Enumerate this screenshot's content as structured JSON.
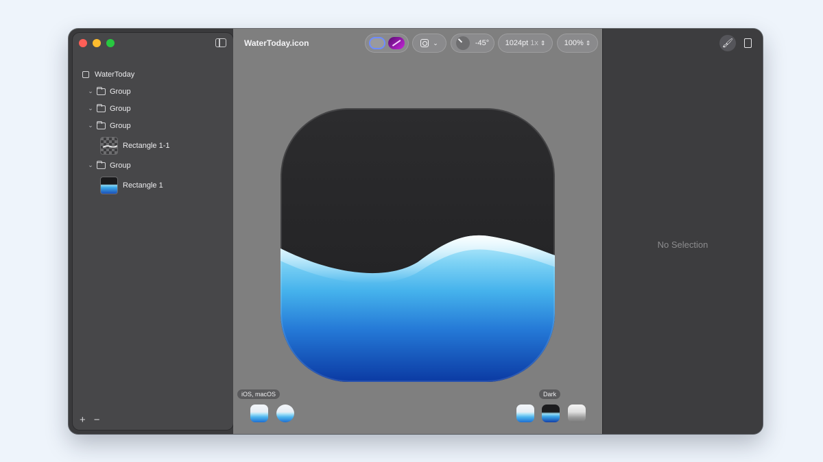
{
  "document": {
    "title": "WaterToday.icon"
  },
  "toolbar": {
    "angle": "-45°",
    "size": "1024pt",
    "scale": "1x",
    "zoom": "100%"
  },
  "sidebar": {
    "items": [
      {
        "label": "WaterToday",
        "kind": "document",
        "depth": 0
      },
      {
        "label": "Group",
        "kind": "group",
        "depth": 1
      },
      {
        "label": "Group",
        "kind": "group",
        "depth": 1
      },
      {
        "label": "Group",
        "kind": "group",
        "depth": 1
      },
      {
        "label": "Rectangle 1-1",
        "kind": "layer",
        "depth": 2,
        "thumb": "checker"
      },
      {
        "label": "Group",
        "kind": "group",
        "depth": 1
      },
      {
        "label": "Rectangle 1",
        "kind": "layer",
        "depth": 2,
        "thumb": "water"
      }
    ],
    "add_label": "+",
    "remove_label": "−"
  },
  "preview": {
    "platform_label": "iOS, macOS",
    "appearance_label": "Dark"
  },
  "inspector": {
    "empty_label": "No Selection"
  },
  "colors": {
    "accent": "#6e8cff",
    "water_top": "#b9ecfb",
    "water_mid": "#47b7ef",
    "water_bottom": "#0b3aa3",
    "icon_bg": "#242426"
  }
}
